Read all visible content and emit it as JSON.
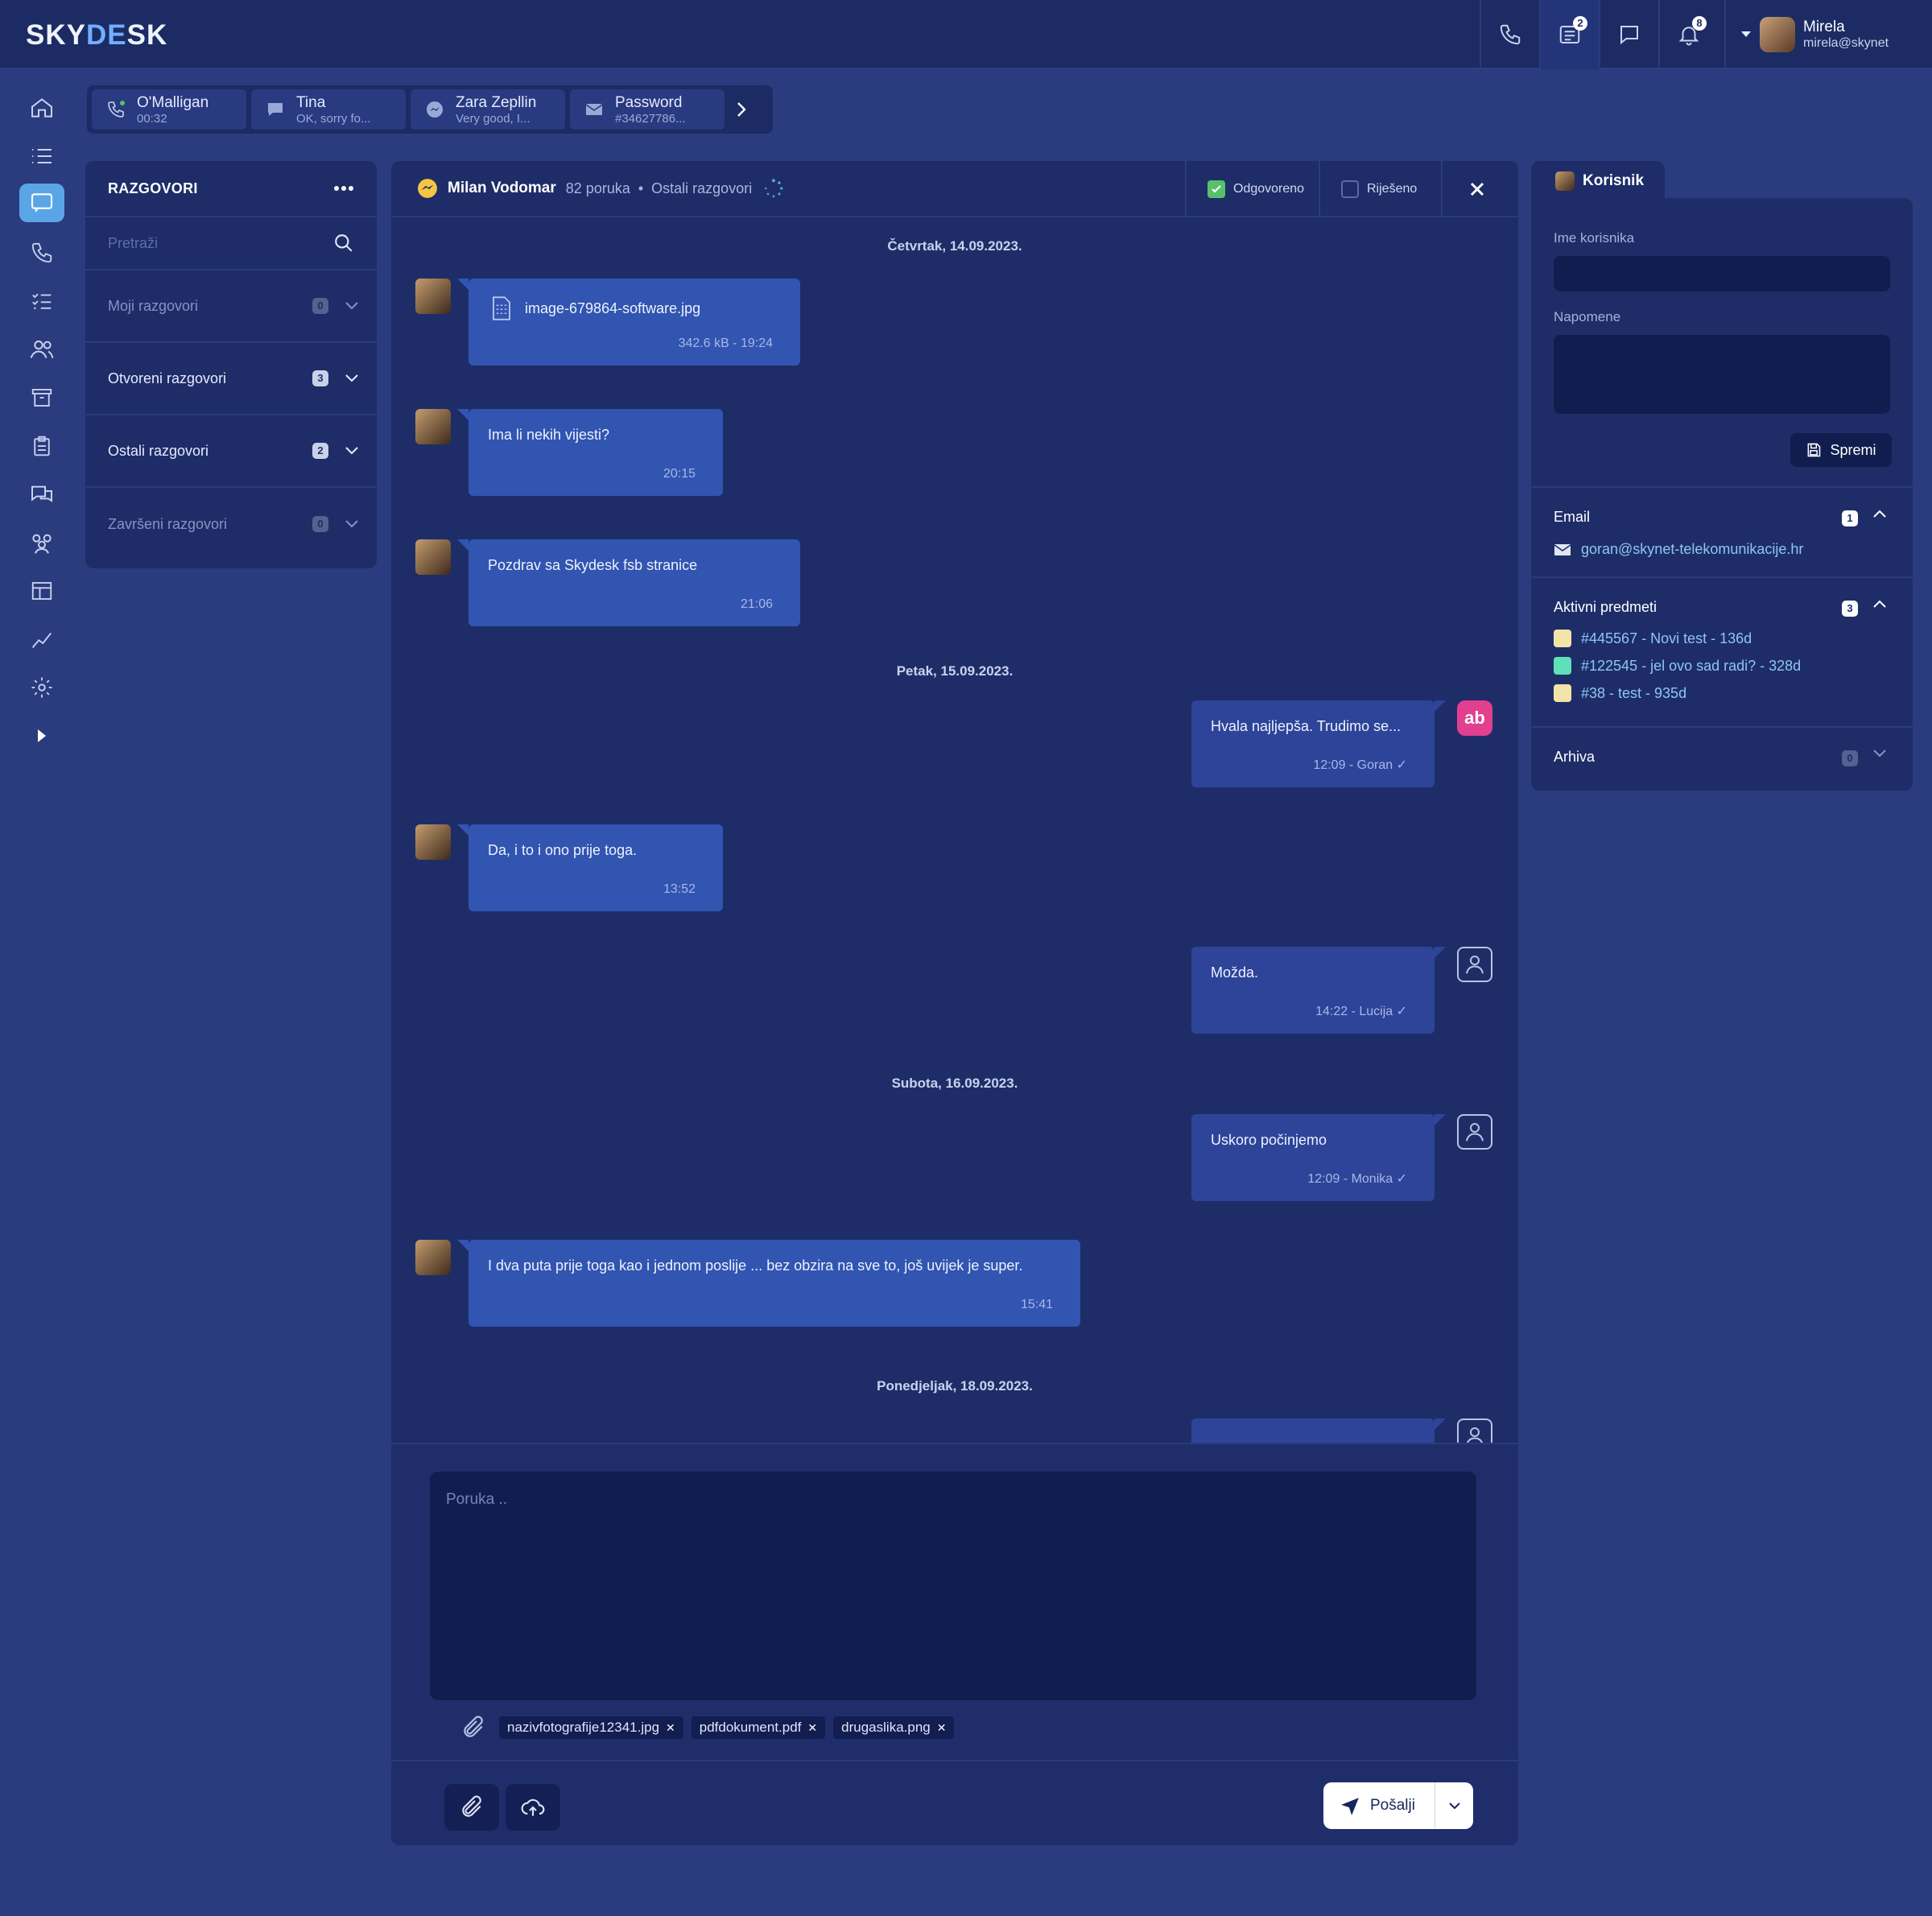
{
  "app": {
    "logo_left": "SKY",
    "logo_mid": "DE",
    "logo_right": "SK"
  },
  "topbar": {
    "icons": [
      "phone-icon",
      "ticket-list-icon",
      "chat-bubble-icon",
      "bell-icon"
    ],
    "tickets_badge": "2",
    "notifications_badge": "8",
    "user_name": "Mirela",
    "user_email": "mirela@skynet"
  },
  "rail": [
    "home-icon",
    "list-icon",
    "chat-icon",
    "phone-icon",
    "tasks-icon",
    "contacts-icon",
    "archive-icon",
    "clipboard-icon",
    "conversations-icon",
    "team-icon",
    "layout-icon",
    "analytics-icon",
    "settings-icon",
    "expand-icon"
  ],
  "quick_tabs": [
    {
      "title": "O'Malligan",
      "sub": "00:32",
      "icon": "phone-icon"
    },
    {
      "title": "Tina",
      "sub": "OK, sorry fo...",
      "icon": "chat-icon"
    },
    {
      "title": "Zara Zepllin",
      "sub": "Very good, I...",
      "icon": "messenger-icon"
    },
    {
      "title": "Password",
      "sub": "#34627786...",
      "icon": "email-icon"
    }
  ],
  "conversations": {
    "title": "RAZGOVORI",
    "search_placeholder": "Pretraži",
    "groups": [
      {
        "label": "Moji razgovori",
        "count": "0"
      },
      {
        "label": "Otvoreni razgovori",
        "count": "3"
      },
      {
        "label": "Ostali razgovori",
        "count": "2"
      },
      {
        "label": "Završeni razgovori",
        "count": "0"
      }
    ]
  },
  "chat": {
    "contact": "Milan Vodomar",
    "message_count": "82 poruka",
    "category": "Ostali razgovori",
    "answered_label": "Odgovoreno",
    "resolved_label": "Riješeno",
    "dates": [
      "Četvrtak, 14.09.2023.",
      "Petak, 15.09.2023.",
      "Subota, 16.09.2023.",
      "Ponedjeljak, 18.09.2023."
    ],
    "messages": [
      {
        "text": "image-679864-software.jpg",
        "time": "342.6 kB - 19:24"
      },
      {
        "text": "Ima li nekih vijesti?",
        "time": "20:15"
      },
      {
        "text": "Pozdrav sa Skydesk fsb stranice",
        "time": "21:06"
      },
      {
        "text": "Hvala najljepša. Trudimo se...",
        "time": "12:09 - Goran ✓"
      },
      {
        "text": "Da, i to i ono prije toga.",
        "time": "13:52"
      },
      {
        "text": "Možda.",
        "time": "14:22 - Lucija ✓"
      },
      {
        "text": "Uskoro počinjemo",
        "time": "12:09 - Monika ✓"
      },
      {
        "text": "I dva puta prije toga kao i jednom poslije ... bez obzira na sve to, još uvijek je super.",
        "time": "15:41"
      }
    ],
    "agent_avatar_text": "ab",
    "input_placeholder": "Poruka ..",
    "attachments": [
      "nazivfotografije12341.jpg",
      "pdfdokument.pdf",
      "drugaslika.png"
    ],
    "send_label": "Pošalji"
  },
  "user_panel": {
    "tab": "Korisnik",
    "name_label": "Ime korisnika",
    "notes_label": "Napomene",
    "save_label": "Spremi",
    "email_header": "Email",
    "email_count": "1",
    "email": "goran@skynet-telekomunikacije.hr",
    "items_header": "Aktivni predmeti",
    "items_count": "3",
    "items": [
      {
        "text": "#445567 - Novi test - 136d",
        "color": "#f2e3a6"
      },
      {
        "text": "#122545 - jel ovo sad radi? - 328d",
        "color": "#5fe0b8"
      },
      {
        "text": "#38 - test - 935d",
        "color": "#f2e3a6"
      }
    ],
    "archive_header": "Arhiva",
    "archive_count": "0"
  }
}
